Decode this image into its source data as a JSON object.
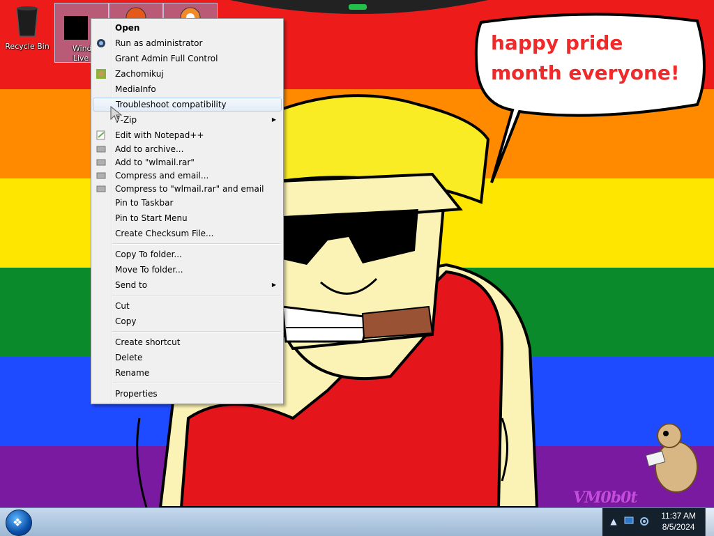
{
  "desktop": {
    "icons": [
      {
        "label": "Recycle Bin"
      },
      {
        "label": "Windows Live Mail"
      }
    ],
    "speech_bubble": "happy pride month everyone!",
    "watermark": "VM0b0t",
    "wallpaper_colors": [
      "#e40303",
      "#ff8c00",
      "#ffed00",
      "#008026",
      "#004dff",
      "#750787"
    ]
  },
  "context_menu": {
    "items": [
      {
        "label": "Open",
        "bold": true,
        "icon": ""
      },
      {
        "label": "Run as administrator",
        "icon": "shield-icon"
      },
      {
        "label": "Grant Admin Full Control",
        "icon": ""
      },
      {
        "label": "Zachomikuj",
        "icon": "chomikuj-icon"
      },
      {
        "label": "MediaInfo",
        "icon": ""
      },
      {
        "label": "Troubleshoot compatibility",
        "icon": "",
        "hover": true
      },
      {
        "label": "7-Zip",
        "icon": "",
        "submenu": true
      },
      {
        "label": "Edit with Notepad++",
        "icon": "notepad-icon"
      },
      {
        "label": "Add to archive...",
        "icon": "rar-icon"
      },
      {
        "label": "Add to \"wlmail.rar\"",
        "icon": "rar-icon"
      },
      {
        "label": "Compress and email...",
        "icon": "rar-icon"
      },
      {
        "label": "Compress to \"wlmail.rar\" and email",
        "icon": "rar-icon"
      },
      {
        "label": "Pin to Taskbar",
        "icon": ""
      },
      {
        "label": "Pin to Start Menu",
        "icon": ""
      },
      {
        "label": "Create Checksum File...",
        "icon": ""
      },
      {
        "label": "Copy To folder...",
        "icon": ""
      },
      {
        "label": "Move To folder...",
        "icon": ""
      },
      {
        "label": "Send to",
        "icon": "",
        "submenu": true
      },
      {
        "label": "Cut",
        "icon": ""
      },
      {
        "label": "Copy",
        "icon": ""
      },
      {
        "label": "Create shortcut",
        "icon": ""
      },
      {
        "label": "Delete",
        "icon": ""
      },
      {
        "label": "Rename",
        "icon": ""
      },
      {
        "label": "Properties",
        "icon": ""
      }
    ]
  },
  "taskbar": {
    "clock_time": "11:37 AM",
    "clock_date": "8/5/2024",
    "color": "#a9c3de"
  }
}
